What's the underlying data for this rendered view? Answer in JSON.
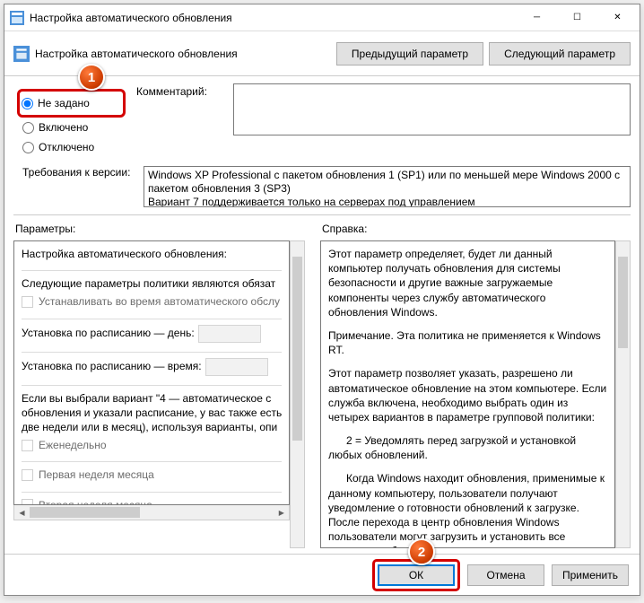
{
  "window": {
    "title": "Настройка автоматического обновления"
  },
  "toolbar": {
    "label": "Настройка автоматического обновления",
    "prev": "Предыдущий параметр",
    "next": "Следующий параметр"
  },
  "state": {
    "notconfigured": "Не задано",
    "enabled": "Включено",
    "disabled": "Отключено",
    "selected": "notconfigured"
  },
  "comment_label": "Комментарий:",
  "requirements_label": "Требования к версии:",
  "requirements_text": "Windows XP Professional с пакетом обновления 1 (SP1) или по меньшей мере Windows 2000 с пакетом обновления 3 (SP3)\nВариант 7 поддерживается только на серверах под управлением",
  "options": {
    "title": "Параметры:",
    "header": "Настройка автоматического обновления:",
    "mandatory": "Следующие параметры политики являются обязат",
    "autoInstall": "Устанавливать во время автоматического обслу",
    "schedDay": "Установка по расписанию — день:",
    "schedTime": "Установка по расписанию — время:",
    "variant4": "Если вы выбрали вариант \"4 — автоматическое с\nобновления и указали расписание, у вас также есть\nдве недели или в месяц), используя варианты, опи",
    "weekly": "Еженедельно",
    "week1": "Первая неделя месяца",
    "week2": "Вторая неделя месяца"
  },
  "help": {
    "title": "Справка:",
    "p1": "Этот параметр определяет, будет ли данный компьютер получать обновления для системы безопасности и другие важные загружаемые компоненты через службу автоматического обновления Windows.",
    "p2": "Примечание. Эта политика не применяется к Windows RT.",
    "p3": "Этот параметр позволяет указать, разрешено ли автоматическое обновление на этом компьютере. Если служба включена, необходимо выбрать один из четырех вариантов в параметре групповой политики:",
    "p4": "2 = Уведомлять перед загрузкой и установкой любых обновлений.",
    "p5": "Когда Windows находит обновления, применимые к данному компьютеру, пользователи получают уведомление о готовности обновлений к загрузке. После перехода в центр обновления Windows пользователи могут загрузить и установить все доступные обнов"
  },
  "buttons": {
    "ok": "ОК",
    "cancel": "Отмена",
    "apply": "Применить"
  },
  "callouts": {
    "c1": "1",
    "c2": "2"
  }
}
